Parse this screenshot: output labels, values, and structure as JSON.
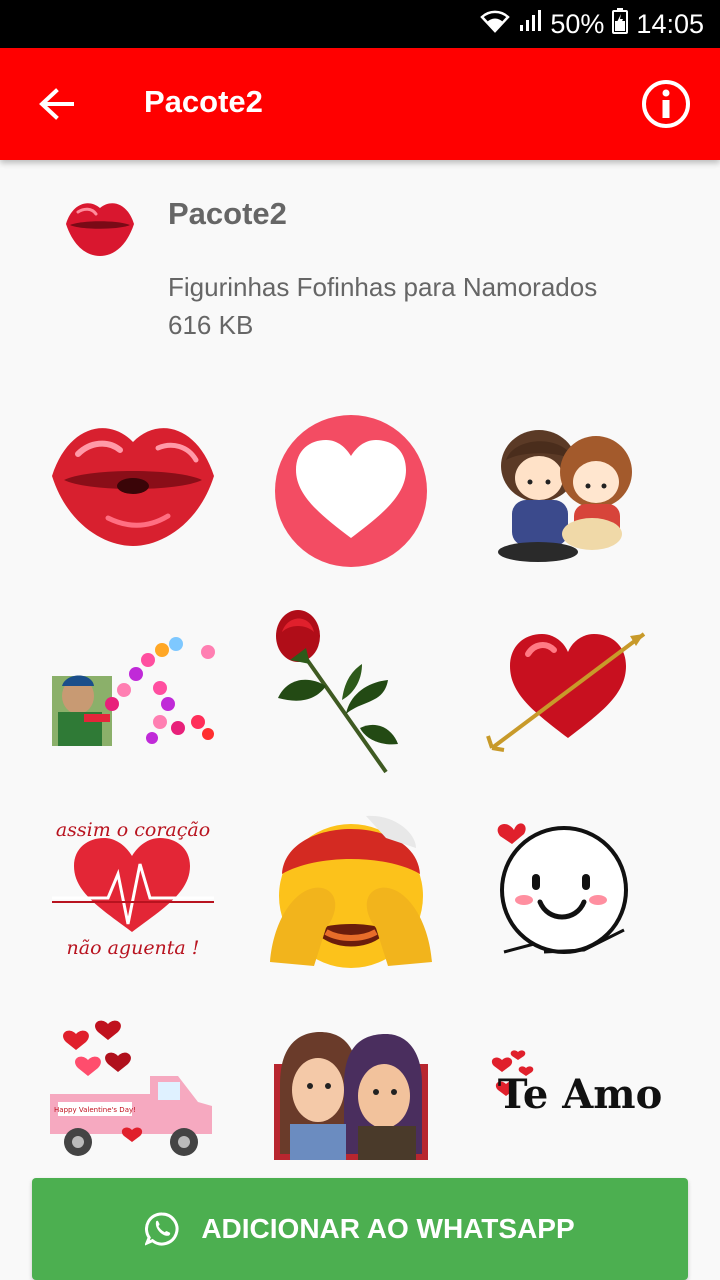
{
  "status_bar": {
    "battery": "50%",
    "time": "14:05"
  },
  "app_bar": {
    "title": "Pacote2"
  },
  "pack": {
    "name": "Pacote2",
    "publisher": "Figurinhas Fofinhas para Namorados",
    "size": "616 KB"
  },
  "stickers": [
    {
      "name": "lips-kiss"
    },
    {
      "name": "heart-circle"
    },
    {
      "name": "couple-chibi"
    },
    {
      "name": "boy-hearts"
    },
    {
      "name": "red-rose"
    },
    {
      "name": "heart-arrow"
    },
    {
      "name": "heartbeat-text",
      "lines": [
        "assim o coração",
        "não aguenta !"
      ]
    },
    {
      "name": "emoji-hands-eyes"
    },
    {
      "name": "smiley-face"
    },
    {
      "name": "valentine-truck",
      "caption": "Happy Valentine's Day!"
    },
    {
      "name": "cartoon-couple"
    },
    {
      "name": "te-amo-text",
      "text": "Te Amo"
    }
  ],
  "add_button": {
    "label": "ADICIONAR AO WHATSAPP"
  },
  "colors": {
    "app_bar": "#ff0000",
    "status_bar": "#000000",
    "button": "#4caf50",
    "text_secondary": "#666666"
  }
}
